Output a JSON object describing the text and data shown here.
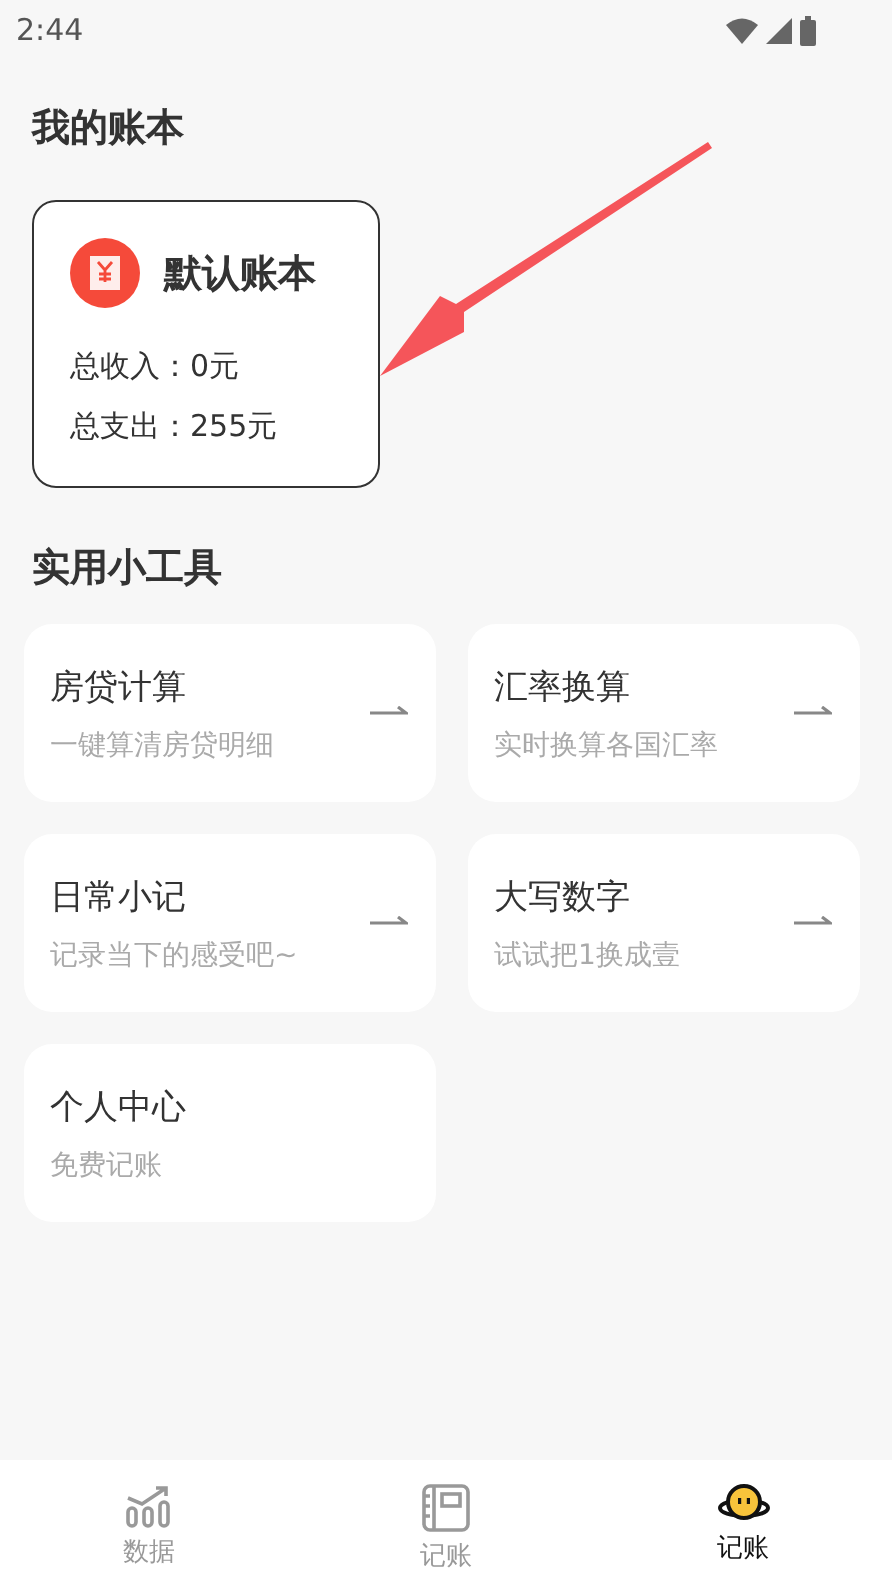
{
  "status_bar": {
    "time": "2:44"
  },
  "ledger_section": {
    "title": "我的账本"
  },
  "ledger": {
    "name": "默认账本",
    "income": "总收入：0元",
    "expense": "总支出：255元"
  },
  "tools_section": {
    "title": "实用小工具"
  },
  "tools": [
    {
      "title": "房贷计算",
      "subtitle": "一键算清房贷明细",
      "arrow": true
    },
    {
      "title": "汇率换算",
      "subtitle": "实时换算各国汇率",
      "arrow": true
    },
    {
      "title": "日常小记",
      "subtitle": "记录当下的感受吧~",
      "arrow": true
    },
    {
      "title": "大写数字",
      "subtitle": "试试把1换成壹",
      "arrow": true
    },
    {
      "title": "个人中心",
      "subtitle": "免费记账",
      "arrow": false
    }
  ],
  "bottom_nav": [
    {
      "label": "数据",
      "kind": "chart",
      "selected": false
    },
    {
      "label": "记账",
      "kind": "book",
      "selected": false
    },
    {
      "label": "记账",
      "kind": "mascot",
      "selected": true
    }
  ]
}
